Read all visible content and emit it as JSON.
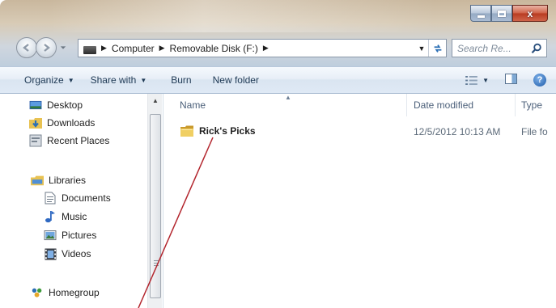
{
  "window": {
    "controls": {
      "minimize": "minimize",
      "maximize": "maximize",
      "close": "x"
    }
  },
  "address_bar": {
    "crumbs": [
      "Computer",
      "Removable Disk (F:)"
    ],
    "search_placeholder": "Search Re..."
  },
  "command_bar": {
    "organize": "Organize",
    "share_with": "Share with",
    "burn": "Burn",
    "new_folder": "New folder"
  },
  "nav_pane": {
    "favorites": [
      "Desktop",
      "Downloads",
      "Recent Places"
    ],
    "libraries_label": "Libraries",
    "libraries": [
      "Documents",
      "Music",
      "Pictures",
      "Videos"
    ],
    "homegroup_label": "Homegroup"
  },
  "file_list": {
    "columns": {
      "name": "Name",
      "date_modified": "Date modified",
      "type": "Type"
    },
    "rows": [
      {
        "name": "Rick's Picks",
        "date_modified": "12/5/2012 10:13 AM",
        "type": "File fo"
      }
    ]
  },
  "colors": {
    "accent": "#1d5aa8",
    "callout_line": "#b3262e",
    "folder": "#e8c252"
  }
}
